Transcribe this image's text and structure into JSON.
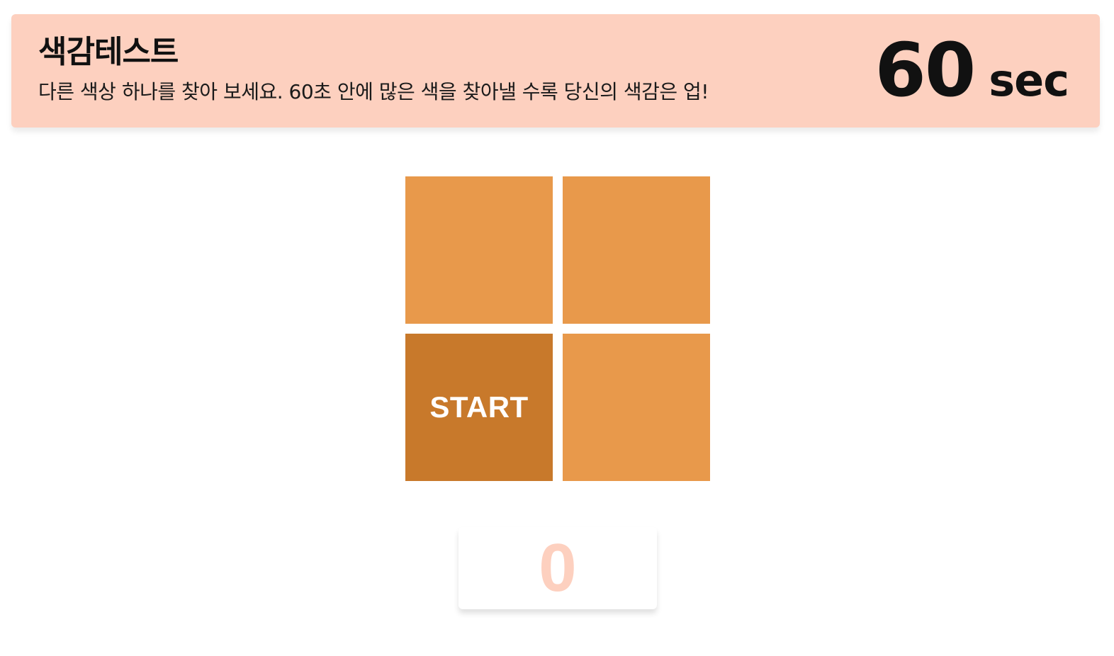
{
  "header": {
    "title": "색감테스트",
    "subtitle": "다른 색상 하나를 찾아 보세요. 60초 안에 많은 색을 찾아낼 수록 당신의 색감은 업!",
    "background_color": "#fdd0bf"
  },
  "timer": {
    "value": "60",
    "unit": "sec"
  },
  "board": {
    "tile_color": "#e8994b",
    "odd_tile_color": "#c8792b",
    "tiles": [
      {
        "label": "",
        "odd": false
      },
      {
        "label": "",
        "odd": false
      },
      {
        "label": "START",
        "odd": true
      },
      {
        "label": "",
        "odd": false
      }
    ]
  },
  "score": {
    "value": "0",
    "color": "#fdd0bf"
  }
}
